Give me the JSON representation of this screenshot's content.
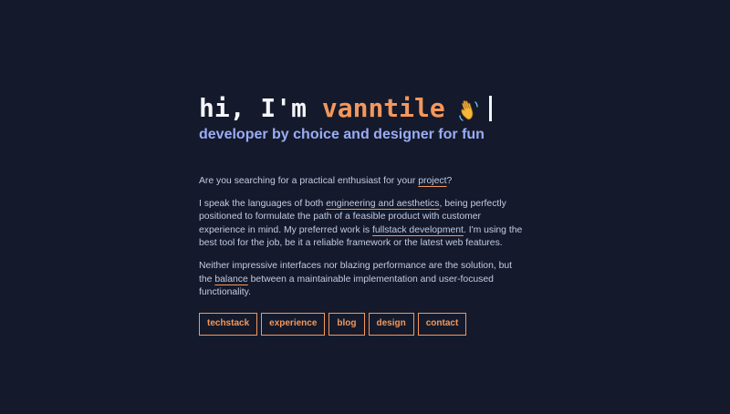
{
  "hero": {
    "greeting": "hi, I'm",
    "name": "vanntile",
    "wave_icon": "waving-hand-emoji",
    "tagline": "developer by choice and designer for fun"
  },
  "about": {
    "p1": {
      "pre": "Are you searching for a practical enthusiast for your",
      "link": "project",
      "post": "?"
    },
    "p2": {
      "pre": "I speak the languages of both",
      "link1": "engineering and aesthetics",
      "mid": ", being perfectly positioned to formulate the path of a feasible product with customer experience in mind. My preferred work is",
      "link2": "fullstack development",
      "post": ". I'm using the best tool for the job, be it a reliable framework or the latest web features."
    },
    "p3": {
      "pre": "Neither impressive interfaces nor blazing performance are the solution, but the",
      "link": "balance",
      "post": "between a maintainable implementation and user-focused functionality."
    }
  },
  "nav": [
    {
      "label": "techstack"
    },
    {
      "label": "experience"
    },
    {
      "label": "blog"
    },
    {
      "label": "design"
    },
    {
      "label": "contact"
    }
  ],
  "colors": {
    "background": "#141a2b",
    "accent": "#f4975c",
    "tagline": "#9aacf5",
    "text": "#c3cbe4"
  }
}
